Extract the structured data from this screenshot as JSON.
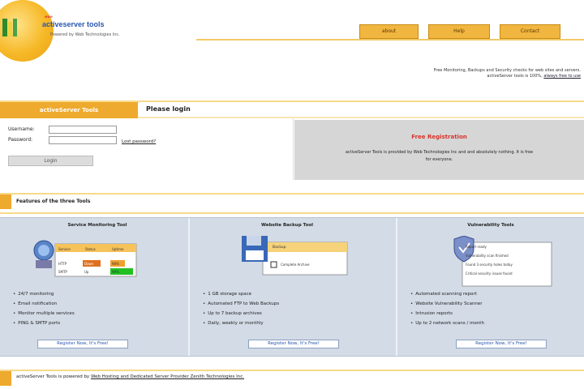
{
  "logo": {
    "small_text": "www",
    "title": "activeserver tools",
    "subtitle": "Powered by Web Technologies Inc."
  },
  "nav": {
    "items": [
      "about",
      "Help",
      "Contact"
    ]
  },
  "promo": {
    "line1": "Free Monitoring, Backups and Security checks for web sites and servers.",
    "line2_prefix": "activeServer tools is 100%, ",
    "line2_link": "always free to use"
  },
  "login": {
    "tab_label": "activeServer Tools",
    "title": "Please login",
    "username_label": "Username:",
    "password_label": "Password:",
    "username_value": "",
    "password_value": "",
    "lost_password": "Lost password?",
    "login_button": "Login"
  },
  "free_panel": {
    "title": "Free Registration",
    "text_line1": "activeServer Tools is provided by Web Technologies Inc and and absolutely nothing. It is free",
    "text_line2": "for everyone."
  },
  "features": {
    "section_title": "Features of the three Tools",
    "columns": [
      {
        "title": "Service Monitoring Tool",
        "items": [
          "24/7 monitoring",
          "Email notification",
          "Monitor multiple services",
          "PING & SMTP ports"
        ],
        "button": "Register Now, It's Free!",
        "table": {
          "headers": [
            "Service",
            "Status",
            "Uptime"
          ],
          "rows": [
            [
              "HTTP",
              "Down",
              "98%"
            ],
            [
              "SMTP",
              "Up",
              "99%"
            ]
          ]
        }
      },
      {
        "title": "Website Backup Tool",
        "items": [
          "1 GB storage space",
          "Automated FTP to Web Backups",
          "Up to 7 backup archives",
          "Daily, weekly or monthly"
        ],
        "button": "Register Now, It's Free!",
        "dialog": {
          "header": "Backup",
          "checkbox_label": "Complete Archive"
        }
      },
      {
        "title": "Vulnerability Tools",
        "items": [
          "Automated scanning report",
          "Website Vulnerability Scanner",
          "Intrusion reports",
          "Up to 2 network scans / month"
        ],
        "button": "Register Now, It's Free!",
        "lines": [
          "Report ready",
          "Vulnerability scan finished",
          "Found 3 security holes today",
          "Critical security issues found"
        ]
      }
    ]
  },
  "footer": {
    "prefix": "activeServer Tools is powered by ",
    "link": "Web Hosting and Dedicated Server Provider Zenith Technologies Inc."
  },
  "colors": {
    "accent": "#eeaa2e",
    "accent_light": "#f7d98a",
    "panel_grey": "#d6d6d6",
    "panel_blue": "#d3dbe6",
    "free_title_red": "#d9342a",
    "link_blue": "#2a56b0"
  }
}
